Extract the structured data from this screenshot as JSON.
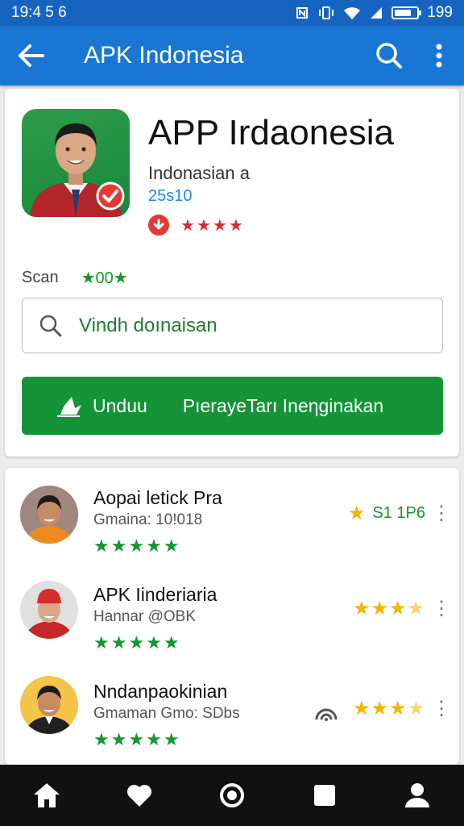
{
  "status_bar": {
    "time": "19:4 5 6",
    "battery_level": 0.75,
    "percent": "199"
  },
  "app_bar": {
    "title": "APK Indonesia",
    "back_icon": "arrow-left-icon",
    "search_icon": "search-icon",
    "menu_icon": "more-vert-icon"
  },
  "app": {
    "name": "APP Irdaonesia",
    "developer": "Indonasian a",
    "size": "25s10",
    "rating_red": 3.5
  },
  "scan": {
    "label": "Scan",
    "value": "★00★"
  },
  "search": {
    "value": "Vindh doınaisan"
  },
  "download_button": {
    "label": "Unduu",
    "description": "PıerayeTarı Ineηginakan"
  },
  "list": [
    {
      "title": "Aopai letick Pra",
      "subtitle": "Gmaina: 10!018",
      "stars": "★★★★★",
      "rating_text": "S1 1P6",
      "gold_stars": 1
    },
    {
      "title": "APK Iinderiaria",
      "subtitle": "Hannar @OBK",
      "stars": "★★★★★",
      "gold_stars": 3.5
    },
    {
      "title": "Nndanpaokinian",
      "subtitle": "Gmaman Gmo: SDbs",
      "stars": "★★★★★",
      "gold_stars": 3.5
    }
  ],
  "bottom_nav": [
    "home-icon",
    "heart-icon",
    "circle-icon",
    "square-icon",
    "profile-icon"
  ],
  "colors": {
    "primary": "#1976d2",
    "status_bar": "#1565c0",
    "accent_green": "#149436",
    "star_gold": "#f5b400",
    "star_red": "#d32f2f"
  }
}
